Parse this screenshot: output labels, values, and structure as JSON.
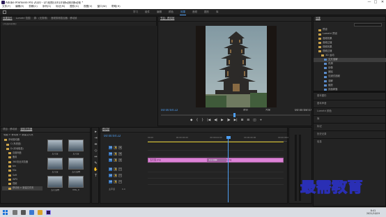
{
  "window": {
    "title": "Adobe Premiere Pro 2020 - D:\\视频\\10\\10\\移动帧\\移动帧 *",
    "controls": [
      "—",
      "□",
      "✕"
    ]
  },
  "menu": [
    "文件(F)",
    "编辑(E)",
    "剪辑(C)",
    "序列(S)",
    "标记(M)",
    "图形(G)",
    "视图(V)",
    "窗口(W)",
    "帮助(H)"
  ],
  "workspaces": {
    "tabs": [
      "学习",
      "组件",
      "编辑",
      "颜色",
      "效果",
      "音频",
      "图形",
      "库"
    ],
    "active": "效果"
  },
  "source_panel": {
    "tabs": [
      "效果控件",
      "Lumetri 范围",
      "源：(无剪辑)",
      "音频剪辑混合器：移动帧"
    ],
    "active": "效果控件",
    "subtitle": "(未选择剪辑)"
  },
  "program_monitor": {
    "title": "节目：移动帧",
    "timecode": "00:00:04:22",
    "duration": "00:00:08:07",
    "fit": "适合",
    "resolution": "完整",
    "transport": [
      "◆",
      "{",
      "}",
      "|◀",
      "◀|",
      "▶",
      "|▶",
      "▶|",
      "⊞",
      "⊟",
      "◫",
      "+"
    ]
  },
  "effects_panel": {
    "title": "效果",
    "items": [
      {
        "label": "预设",
        "type": "folder",
        "indent": 1,
        "selected": false
      },
      {
        "label": "Lumetri 预设",
        "type": "folder",
        "indent": 1,
        "selected": false
      },
      {
        "label": "音频效果",
        "type": "folder",
        "indent": 1,
        "selected": false
      },
      {
        "label": "音频过渡",
        "type": "folder",
        "indent": 1,
        "selected": false
      },
      {
        "label": "视频效果",
        "type": "folder",
        "indent": 1,
        "selected": false
      },
      {
        "label": "视频过渡",
        "type": "folder",
        "indent": 1,
        "selected": false
      },
      {
        "label": "3D 运动",
        "type": "folder",
        "indent": 2,
        "selected": false
      },
      {
        "label": "交叉溶解",
        "type": "effect",
        "indent": 3,
        "selected": true
      },
      {
        "label": "内滑",
        "type": "effect",
        "indent": 3,
        "selected": false
      },
      {
        "label": "划像",
        "type": "effect",
        "indent": 3,
        "selected": false
      },
      {
        "label": "擦除",
        "type": "effect",
        "indent": 3,
        "selected": false
      },
      {
        "label": "沉浸式视频",
        "type": "effect",
        "indent": 3,
        "selected": false
      },
      {
        "label": "溶解",
        "type": "effect",
        "indent": 3,
        "selected": false
      },
      {
        "label": "缩放",
        "type": "effect",
        "indent": 3,
        "selected": false
      },
      {
        "label": "页面剥落",
        "type": "effect",
        "indent": 3,
        "selected": false
      }
    ]
  },
  "right_panels": [
    "基本图形",
    "基本声音",
    "Lumetri 颜色",
    "库",
    "标记",
    "历史记录",
    "信息"
  ],
  "project_panel": {
    "tabs": [
      "项目：移动帧",
      "媒体浏览器"
    ],
    "active": "媒体浏览器",
    "path": "电脑 > 移动帧 > 新建文件夹",
    "tree": [
      "本地驱动器",
      "C:(系统盘)",
      "D:(本地磁盘)",
      "百度网盘",
      "备用",
      "360安全浏览器",
      "bin",
      "Mix",
      "Soft",
      "WPS",
      "视频",
      "移动帧 > 新建文件夹"
    ],
    "thumbnails": [
      {
        "label": "五元宝"
      },
      {
        "label": "五元宝"
      },
      {
        "label": "五元宝"
      },
      {
        "label": "五元宝物"
      },
      {
        "label": "五元宝物"
      },
      {
        "label": "IMG_0"
      }
    ]
  },
  "timeline": {
    "tab": "移动帧",
    "timecode": "00:00:04:22",
    "ruler": [
      "00:00",
      "00:00:02:00",
      "00:00:04:00",
      "00:00:06:00",
      "00:00:08:00"
    ],
    "tracks": {
      "video": [
        "V3",
        "V2",
        "V1"
      ],
      "audio": [
        "A1",
        "A2",
        "A3"
      ],
      "master": "主声道",
      "master_value": "0.0"
    },
    "clips": [
      {
        "label": "五元宝.png",
        "track": "V1",
        "start": 0,
        "end": 4.2
      },
      {
        "label": "交叉溶解",
        "track": "V1",
        "start": 3.6,
        "end": 4.8
      },
      {
        "label": "五元宝物.png",
        "track": "V1",
        "start": 4.2,
        "end": 8.3
      }
    ],
    "playhead_seconds": 4.9,
    "duration_seconds": 8.3
  },
  "taskbar": {
    "clock_time": "8:41",
    "clock_date": "2021/10/19"
  },
  "watermark": "最需教育"
}
